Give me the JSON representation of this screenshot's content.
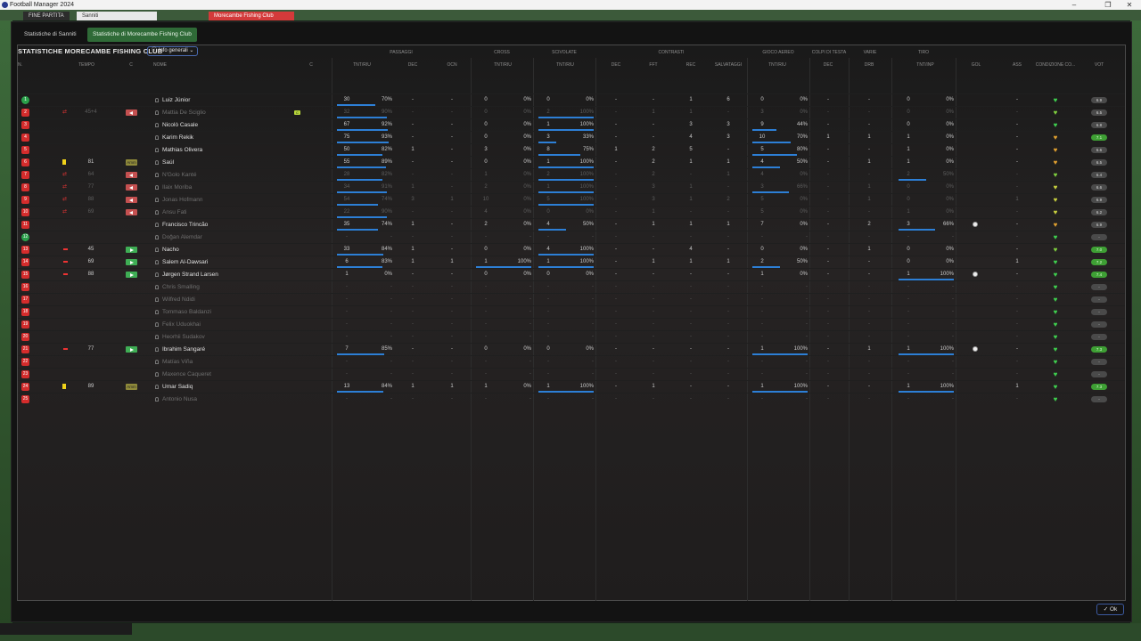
{
  "app": {
    "title": "Football Manager 2024",
    "min": "–",
    "max": "❐",
    "close": "✕"
  },
  "bg": {
    "btn1": "FINE PARTITA",
    "btn2": "Sanniti",
    "btn3": "Morecambe Fishing Club"
  },
  "tabs": [
    {
      "label": "Statistiche di Sanniti"
    },
    {
      "label": "Statistiche di Morecambe Fishing Club"
    }
  ],
  "panel": {
    "title": "STATISTICHE MORECAMBE FISHING CLUB",
    "dropdown": "Info generali"
  },
  "groups": {
    "passaggi": "PASSAGGI",
    "cross": "CROSS",
    "scivolate": "SCIVOLATE",
    "contrasti": "CONTRASTI",
    "aereo": "GIOCO AEREO",
    "testa": "COLPI DI TESTA",
    "varie": "VARIE",
    "tiro": "TIRO"
  },
  "cols": {
    "n": "N.",
    "tempo": "TEMPO",
    "c": "C",
    "nome": "NOME",
    "c2": "C",
    "tnt": "TNT/RIU",
    "dec": "DEC",
    "ocn": "OCN",
    "cross_tnt": "TNT/RIU",
    "sciv_tnt": "TNT/RIU",
    "cdec": "DEC",
    "fft": "FFT",
    "rec": "REC",
    "salv": "SALVATAGGI",
    "aer_tnt": "TNT/RIU",
    "tdec": "DEC",
    "drb": "DRB",
    "tiro_tnt": "TNT/INP",
    "gol": "GOL",
    "ass": "ASS",
    "cond": "CONDIZIONE CO...",
    "vot": "VOT"
  },
  "rows": [
    {
      "badge": "1",
      "b": "green",
      "tempo": "",
      "minute": "",
      "sub": "",
      "name": "Luiz Júnior",
      "dim": false,
      "cap": "",
      "pt": "30",
      "pp": "70%",
      "pu": 0.7,
      "pd": "-",
      "po": "-",
      "ct": "0",
      "cp": "0%",
      "cu": 0,
      "st": "0",
      "sp": "0%",
      "su": 0,
      "dec": "-",
      "fft": "-",
      "rec": "1",
      "salv": "6",
      "at": "0",
      "ap": "0%",
      "au": 0,
      "hd": "-",
      "drb": "-",
      "tt": "0",
      "tp": "0%",
      "tu": 0,
      "gol": "",
      "goal": false,
      "ass": "-",
      "heart": "#3fd04f",
      "vote": "6.9",
      "vg": false
    },
    {
      "badge": "2",
      "b": "red",
      "tempo": "ar",
      "minute": "45+4",
      "sub": "out",
      "name": "Mattia De Sciglio",
      "dim": true,
      "cap": "C",
      "pt": "32",
      "pp": "90%",
      "pu": 0.9,
      "pd": "-",
      "po": "-",
      "ct": "0",
      "cp": "0%",
      "cu": 0,
      "st": "2",
      "sp": "100%",
      "su": 1,
      "dec": "-",
      "fft": "1",
      "rec": "1",
      "salv": "-",
      "at": "3",
      "ap": "0%",
      "au": 0,
      "hd": "-",
      "drb": "-",
      "tt": "0",
      "tp": "0%",
      "tu": 0,
      "gol": "",
      "goal": false,
      "ass": "-",
      "heart": "#7fd03f",
      "vote": "6.5",
      "vg": false
    },
    {
      "badge": "3",
      "b": "red",
      "tempo": "",
      "minute": "",
      "sub": "",
      "name": "Nicolò Casale",
      "dim": false,
      "cap": "",
      "pt": "67",
      "pp": "92%",
      "pu": 0.92,
      "pd": "-",
      "po": "-",
      "ct": "0",
      "cp": "0%",
      "cu": 0,
      "st": "1",
      "sp": "100%",
      "su": 1,
      "dec": "-",
      "fft": "-",
      "rec": "3",
      "salv": "3",
      "at": "9",
      "ap": "44%",
      "au": 0.44,
      "hd": "-",
      "drb": "-",
      "tt": "0",
      "tp": "0%",
      "tu": 0,
      "gol": "",
      "goal": false,
      "ass": "-",
      "heart": "#3fd04f",
      "vote": "6.8",
      "vg": false
    },
    {
      "badge": "4",
      "b": "red",
      "tempo": "",
      "minute": "",
      "sub": "",
      "name": "Karim Rekik",
      "dim": false,
      "cap": "",
      "pt": "75",
      "pp": "93%",
      "pu": 0.93,
      "pd": "-",
      "po": "-",
      "ct": "0",
      "cp": "0%",
      "cu": 0,
      "st": "3",
      "sp": "33%",
      "su": 0.33,
      "dec": "-",
      "fft": "-",
      "rec": "4",
      "salv": "3",
      "at": "10",
      "ap": "70%",
      "au": 0.7,
      "hd": "1",
      "drb": "1",
      "tt": "1",
      "tp": "0%",
      "tu": 0,
      "gol": "",
      "goal": false,
      "ass": "-",
      "heart": "#e0a030",
      "vote": "7.1",
      "vg": true
    },
    {
      "badge": "5",
      "b": "red",
      "tempo": "",
      "minute": "",
      "sub": "",
      "name": "Mathias Olivera",
      "dim": false,
      "cap": "",
      "pt": "50",
      "pp": "82%",
      "pu": 0.82,
      "pd": "1",
      "po": "-",
      "ct": "3",
      "cp": "0%",
      "cu": 0,
      "st": "8",
      "sp": "75%",
      "su": 0.75,
      "dec": "1",
      "fft": "2",
      "rec": "5",
      "salv": "-",
      "at": "5",
      "ap": "80%",
      "au": 0.8,
      "hd": "-",
      "drb": "-",
      "tt": "1",
      "tp": "0%",
      "tu": 0,
      "gol": "",
      "goal": false,
      "ass": "-",
      "heart": "#e0a030",
      "vote": "6.6",
      "vg": false
    },
    {
      "badge": "6",
      "b": "red",
      "tempo": "yc",
      "minute": "81",
      "sub": "amm",
      "name": "Saúl",
      "dim": false,
      "cap": "",
      "pt": "55",
      "pp": "89%",
      "pu": 0.89,
      "pd": "-",
      "po": "-",
      "ct": "0",
      "cp": "0%",
      "cu": 0,
      "st": "1",
      "sp": "100%",
      "su": 1,
      "dec": "-",
      "fft": "2",
      "rec": "1",
      "salv": "1",
      "at": "4",
      "ap": "50%",
      "au": 0.5,
      "hd": "-",
      "drb": "1",
      "tt": "1",
      "tp": "0%",
      "tu": 0,
      "gol": "",
      "goal": false,
      "ass": "-",
      "heart": "#e0a030",
      "vote": "6.5",
      "vg": false
    },
    {
      "badge": "7",
      "b": "red",
      "tempo": "ar",
      "minute": "64",
      "sub": "out",
      "name": "N'Golo Kanté",
      "dim": true,
      "cap": "",
      "pt": "28",
      "pp": "82%",
      "pu": 0.82,
      "pd": "-",
      "po": "-",
      "ct": "1",
      "cp": "0%",
      "cu": 0,
      "st": "2",
      "sp": "100%",
      "su": 1,
      "dec": "-",
      "fft": "2",
      "rec": "-",
      "salv": "1",
      "at": "4",
      "ap": "0%",
      "au": 0,
      "hd": "-",
      "drb": "-",
      "tt": "2",
      "tp": "50%",
      "tu": 0.5,
      "gol": "",
      "goal": false,
      "ass": "-",
      "heart": "#7fd03f",
      "vote": "6.4",
      "vg": false
    },
    {
      "badge": "8",
      "b": "red",
      "tempo": "ar",
      "minute": "77",
      "sub": "out",
      "name": "Ilaix Moriba",
      "dim": true,
      "cap": "",
      "pt": "34",
      "pp": "91%",
      "pu": 0.91,
      "pd": "1",
      "po": "-",
      "ct": "2",
      "cp": "0%",
      "cu": 0,
      "st": "1",
      "sp": "100%",
      "su": 1,
      "dec": "-",
      "fft": "3",
      "rec": "1",
      "salv": "-",
      "at": "3",
      "ap": "66%",
      "au": 0.66,
      "hd": "-",
      "drb": "1",
      "tt": "0",
      "tp": "0%",
      "tu": 0,
      "gol": "",
      "goal": false,
      "ass": "-",
      "heart": "#c8d03f",
      "vote": "6.6",
      "vg": false
    },
    {
      "badge": "9",
      "b": "red",
      "tempo": "ar",
      "minute": "88",
      "sub": "out",
      "name": "Jonas Hofmann",
      "dim": true,
      "cap": "",
      "pt": "54",
      "pp": "74%",
      "pu": 0.74,
      "pd": "3",
      "po": "1",
      "ct": "10",
      "cp": "0%",
      "cu": 0,
      "st": "5",
      "sp": "100%",
      "su": 1,
      "dec": "-",
      "fft": "3",
      "rec": "1",
      "salv": "2",
      "at": "5",
      "ap": "0%",
      "au": 0,
      "hd": "-",
      "drb": "1",
      "tt": "0",
      "tp": "0%",
      "tu": 0,
      "gol": "",
      "goal": false,
      "ass": "1",
      "heart": "#c8d03f",
      "vote": "6.9",
      "vg": false
    },
    {
      "badge": "10",
      "b": "red",
      "tempo": "ar",
      "minute": "69",
      "sub": "out",
      "name": "Ansu Fati",
      "dim": true,
      "cap": "",
      "pt": "22",
      "pp": "90%",
      "pu": 0.9,
      "pd": "-",
      "po": "-",
      "ct": "4",
      "cp": "0%",
      "cu": 0,
      "st": "0",
      "sp": "0%",
      "su": 0,
      "dec": "-",
      "fft": "1",
      "rec": "-",
      "salv": "-",
      "at": "5",
      "ap": "0%",
      "au": 0,
      "hd": "-",
      "drb": "-",
      "tt": "1",
      "tp": "0%",
      "tu": 0,
      "gol": "",
      "goal": false,
      "ass": "-",
      "heart": "#c8d03f",
      "vote": "6.2",
      "vg": false
    },
    {
      "badge": "11",
      "b": "red",
      "tempo": "",
      "minute": "",
      "sub": "",
      "name": "Francisco Trincão",
      "dim": false,
      "cap": "",
      "pt": "35",
      "pp": "74%",
      "pu": 0.74,
      "pd": "1",
      "po": "-",
      "ct": "2",
      "cp": "0%",
      "cu": 0,
      "st": "4",
      "sp": "50%",
      "su": 0.5,
      "dec": "-",
      "fft": "1",
      "rec": "1",
      "salv": "1",
      "at": "7",
      "ap": "0%",
      "au": 0,
      "hd": "-",
      "drb": "2",
      "tt": "3",
      "tp": "66%",
      "tu": 0.66,
      "gol": "",
      "goal": true,
      "ass": "-",
      "heart": "#e0a030",
      "vote": "6.9",
      "vg": false
    },
    {
      "badge": "12",
      "b": "green",
      "tempo": "",
      "minute": "",
      "sub": "",
      "name": "Doğan Alemdar",
      "dim": true,
      "cap": "",
      "pt": "-",
      "pp": "-",
      "pu": 0,
      "pd": "-",
      "po": "-",
      "ct": "-",
      "cp": "-",
      "cu": 0,
      "st": "-",
      "sp": "-",
      "su": 0,
      "dec": "-",
      "fft": "-",
      "rec": "-",
      "salv": "-",
      "at": "-",
      "ap": "-",
      "au": 0,
      "hd": "-",
      "drb": "-",
      "tt": "-",
      "tp": "-",
      "tu": 0,
      "gol": "",
      "goal": false,
      "ass": "-",
      "heart": "#3fd04f",
      "vote": "-",
      "vg": false
    },
    {
      "badge": "13",
      "b": "red",
      "tempo": "rc",
      "minute": "45",
      "sub": "in",
      "name": "Nacho",
      "dim": false,
      "cap": "",
      "pt": "33",
      "pp": "84%",
      "pu": 0.84,
      "pd": "1",
      "po": "-",
      "ct": "0",
      "cp": "0%",
      "cu": 0,
      "st": "4",
      "sp": "100%",
      "su": 1,
      "dec": "-",
      "fft": "-",
      "rec": "4",
      "salv": "-",
      "at": "0",
      "ap": "0%",
      "au": 0,
      "hd": "-",
      "drb": "1",
      "tt": "0",
      "tp": "0%",
      "tu": 0,
      "gol": "",
      "goal": false,
      "ass": "-",
      "heart": "#7fd03f",
      "vote": "7.0",
      "vg": true
    },
    {
      "badge": "14",
      "b": "red",
      "tempo": "rc",
      "minute": "69",
      "sub": "in",
      "name": "Salem Al-Dawsari",
      "dim": false,
      "cap": "",
      "pt": "6",
      "pp": "83%",
      "pu": 0.83,
      "pd": "1",
      "po": "1",
      "ct": "1",
      "cp": "100%",
      "cu": 1,
      "st": "1",
      "sp": "100%",
      "su": 1,
      "dec": "-",
      "fft": "1",
      "rec": "1",
      "salv": "1",
      "at": "2",
      "ap": "50%",
      "au": 0.5,
      "hd": "-",
      "drb": "-",
      "tt": "0",
      "tp": "0%",
      "tu": 0,
      "gol": "",
      "goal": false,
      "ass": "1",
      "heart": "#3fd04f",
      "vote": "7.2",
      "vg": true
    },
    {
      "badge": "15",
      "b": "red",
      "tempo": "rc",
      "minute": "88",
      "sub": "in",
      "name": "Jørgen Strand Larsen",
      "dim": false,
      "cap": "",
      "pt": "1",
      "pp": "0%",
      "pu": 0,
      "pd": "-",
      "po": "-",
      "ct": "0",
      "cp": "0%",
      "cu": 0,
      "st": "0",
      "sp": "0%",
      "su": 0,
      "dec": "-",
      "fft": "-",
      "rec": "-",
      "salv": "-",
      "at": "1",
      "ap": "0%",
      "au": 0,
      "hd": "-",
      "drb": "-",
      "tt": "1",
      "tp": "100%",
      "tu": 1,
      "gol": "",
      "goal": true,
      "ass": "-",
      "heart": "#3fd04f",
      "vote": "7.4",
      "vg": true
    },
    {
      "badge": "16",
      "b": "red",
      "tempo": "",
      "minute": "",
      "sub": "",
      "name": "Chris Smalling",
      "dim": true,
      "cap": "",
      "pt": "-",
      "pp": "-",
      "pu": 0,
      "pd": "-",
      "po": "-",
      "ct": "-",
      "cp": "-",
      "cu": 0,
      "st": "-",
      "sp": "-",
      "su": 0,
      "dec": "-",
      "fft": "-",
      "rec": "-",
      "salv": "-",
      "at": "-",
      "ap": "-",
      "au": 0,
      "hd": "-",
      "drb": "-",
      "tt": "-",
      "tp": "-",
      "tu": 0,
      "gol": "",
      "goal": false,
      "ass": "-",
      "heart": "#3fd04f",
      "vote": "-",
      "vg": false
    },
    {
      "badge": "17",
      "b": "red",
      "tempo": "",
      "minute": "",
      "sub": "",
      "name": "Wilfred Ndidi",
      "dim": true,
      "cap": "",
      "pt": "-",
      "pp": "-",
      "pu": 0,
      "pd": "-",
      "po": "-",
      "ct": "-",
      "cp": "-",
      "cu": 0,
      "st": "-",
      "sp": "-",
      "su": 0,
      "dec": "-",
      "fft": "-",
      "rec": "-",
      "salv": "-",
      "at": "-",
      "ap": "-",
      "au": 0,
      "hd": "-",
      "drb": "-",
      "tt": "-",
      "tp": "-",
      "tu": 0,
      "gol": "",
      "goal": false,
      "ass": "-",
      "heart": "#3fd04f",
      "vote": "-",
      "vg": false
    },
    {
      "badge": "18",
      "b": "red",
      "tempo": "",
      "minute": "",
      "sub": "",
      "name": "Tommaso Baldanzi",
      "dim": true,
      "cap": "",
      "pt": "-",
      "pp": "-",
      "pu": 0,
      "pd": "-",
      "po": "-",
      "ct": "-",
      "cp": "-",
      "cu": 0,
      "st": "-",
      "sp": "-",
      "su": 0,
      "dec": "-",
      "fft": "-",
      "rec": "-",
      "salv": "-",
      "at": "-",
      "ap": "-",
      "au": 0,
      "hd": "-",
      "drb": "-",
      "tt": "-",
      "tp": "-",
      "tu": 0,
      "gol": "",
      "goal": false,
      "ass": "-",
      "heart": "#3fd04f",
      "vote": "-",
      "vg": false
    },
    {
      "badge": "19",
      "b": "red",
      "tempo": "",
      "minute": "",
      "sub": "",
      "name": "Felix Uduokhai",
      "dim": true,
      "cap": "",
      "pt": "-",
      "pp": "-",
      "pu": 0,
      "pd": "-",
      "po": "-",
      "ct": "-",
      "cp": "-",
      "cu": 0,
      "st": "-",
      "sp": "-",
      "su": 0,
      "dec": "-",
      "fft": "-",
      "rec": "-",
      "salv": "-",
      "at": "-",
      "ap": "-",
      "au": 0,
      "hd": "-",
      "drb": "-",
      "tt": "-",
      "tp": "-",
      "tu": 0,
      "gol": "",
      "goal": false,
      "ass": "-",
      "heart": "#3fd04f",
      "vote": "-",
      "vg": false
    },
    {
      "badge": "20",
      "b": "red",
      "tempo": "",
      "minute": "",
      "sub": "",
      "name": "Heorhii Sudakov",
      "dim": true,
      "cap": "",
      "pt": "-",
      "pp": "-",
      "pu": 0,
      "pd": "-",
      "po": "-",
      "ct": "-",
      "cp": "-",
      "cu": 0,
      "st": "-",
      "sp": "-",
      "su": 0,
      "dec": "-",
      "fft": "-",
      "rec": "-",
      "salv": "-",
      "at": "-",
      "ap": "-",
      "au": 0,
      "hd": "-",
      "drb": "-",
      "tt": "-",
      "tp": "-",
      "tu": 0,
      "gol": "",
      "goal": false,
      "ass": "-",
      "heart": "#3fd04f",
      "vote": "-",
      "vg": false
    },
    {
      "badge": "21",
      "b": "red",
      "tempo": "rc",
      "minute": "77",
      "sub": "in",
      "name": "Ibrahim Sangaré",
      "dim": false,
      "cap": "",
      "pt": "7",
      "pp": "85%",
      "pu": 0.85,
      "pd": "-",
      "po": "-",
      "ct": "0",
      "cp": "0%",
      "cu": 0,
      "st": "0",
      "sp": "0%",
      "su": 0,
      "dec": "-",
      "fft": "-",
      "rec": "-",
      "salv": "-",
      "at": "1",
      "ap": "100%",
      "au": 1,
      "hd": "-",
      "drb": "1",
      "tt": "1",
      "tp": "100%",
      "tu": 1,
      "gol": "",
      "goal": true,
      "ass": "-",
      "heart": "#3fd04f",
      "vote": "7.3",
      "vg": true
    },
    {
      "badge": "22",
      "b": "red",
      "tempo": "",
      "minute": "",
      "sub": "",
      "name": "Matías Viña",
      "dim": true,
      "cap": "",
      "pt": "-",
      "pp": "-",
      "pu": 0,
      "pd": "-",
      "po": "-",
      "ct": "-",
      "cp": "-",
      "cu": 0,
      "st": "-",
      "sp": "-",
      "su": 0,
      "dec": "-",
      "fft": "-",
      "rec": "-",
      "salv": "-",
      "at": "-",
      "ap": "-",
      "au": 0,
      "hd": "-",
      "drb": "-",
      "tt": "-",
      "tp": "-",
      "tu": 0,
      "gol": "",
      "goal": false,
      "ass": "-",
      "heart": "#3fd04f",
      "vote": "-",
      "vg": false
    },
    {
      "badge": "23",
      "b": "red",
      "tempo": "",
      "minute": "",
      "sub": "",
      "name": "Maxence Caqueret",
      "dim": true,
      "cap": "",
      "pt": "-",
      "pp": "-",
      "pu": 0,
      "pd": "-",
      "po": "-",
      "ct": "-",
      "cp": "-",
      "cu": 0,
      "st": "-",
      "sp": "-",
      "su": 0,
      "dec": "-",
      "fft": "-",
      "rec": "-",
      "salv": "-",
      "at": "-",
      "ap": "-",
      "au": 0,
      "hd": "-",
      "drb": "-",
      "tt": "-",
      "tp": "-",
      "tu": 0,
      "gol": "",
      "goal": false,
      "ass": "-",
      "heart": "#3fd04f",
      "vote": "-",
      "vg": false
    },
    {
      "badge": "24",
      "b": "red",
      "tempo": "yc",
      "minute": "89",
      "sub": "amm",
      "name": "Umar Sadiq",
      "dim": false,
      "cap": "",
      "pt": "13",
      "pp": "84%",
      "pu": 0.84,
      "pd": "1",
      "po": "1",
      "ct": "1",
      "cp": "0%",
      "cu": 0,
      "st": "1",
      "sp": "100%",
      "su": 1,
      "dec": "-",
      "fft": "1",
      "rec": "-",
      "salv": "-",
      "at": "1",
      "ap": "100%",
      "au": 1,
      "hd": "-",
      "drb": "-",
      "tt": "1",
      "tp": "100%",
      "tu": 1,
      "gol": "",
      "goal": false,
      "ass": "1",
      "heart": "#3fd04f",
      "vote": "7.3",
      "vg": true
    },
    {
      "badge": "25",
      "b": "red",
      "tempo": "",
      "minute": "",
      "sub": "",
      "name": "Antonio Nusa",
      "dim": true,
      "cap": "",
      "pt": "-",
      "pp": "-",
      "pu": 0,
      "pd": "-",
      "po": "-",
      "ct": "-",
      "cp": "-",
      "cu": 0,
      "st": "-",
      "sp": "-",
      "su": 0,
      "dec": "-",
      "fft": "-",
      "rec": "-",
      "salv": "-",
      "at": "-",
      "ap": "-",
      "au": 0,
      "hd": "-",
      "drb": "-",
      "tt": "-",
      "tp": "-",
      "tu": 0,
      "gol": "",
      "goal": false,
      "ass": "-",
      "heart": "#3fd04f",
      "vote": "-",
      "vg": false
    }
  ],
  "sub_labels": {
    "amm": "Amm"
  },
  "ok": {
    "label": "✓ Ok"
  }
}
